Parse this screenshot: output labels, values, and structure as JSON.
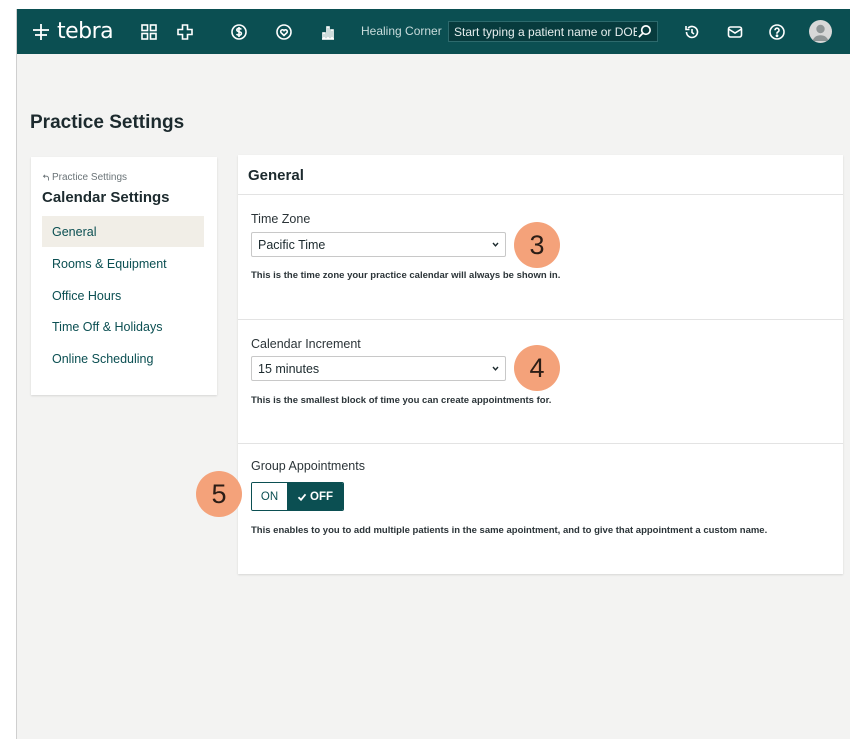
{
  "topbar": {
    "logo_text": "tebra",
    "icons": [
      "apps-grid-icon",
      "medical-cross-icon",
      "dollar-icon",
      "heart-icon",
      "bar-chart-icon"
    ],
    "practice_name": "Healing Corner",
    "search_placeholder": "Start typing a patient name or DOB",
    "right_icons": [
      "history-icon",
      "mail-icon",
      "help-icon",
      "user-avatar"
    ],
    "brand_color": "#0b4f52"
  },
  "page": {
    "title": "Practice Settings"
  },
  "sidebar": {
    "back_label": "Practice Settings",
    "title": "Calendar Settings",
    "items": [
      {
        "label": "General",
        "active": true
      },
      {
        "label": "Rooms & Equipment",
        "active": false
      },
      {
        "label": "Office Hours",
        "active": false
      },
      {
        "label": "Time Off & Holidays",
        "active": false
      },
      {
        "label": "Online Scheduling",
        "active": false
      }
    ]
  },
  "main": {
    "header": "General",
    "time_zone": {
      "label": "Time Zone",
      "value": "Pacific Time",
      "help": "This is the time zone your practice calendar will always be shown in."
    },
    "calendar_increment": {
      "label": "Calendar Increment",
      "value": "15 minutes",
      "help": "This is the smallest block of time you can create appointments for."
    },
    "group_appointments": {
      "label": "Group Appointments",
      "on_label": "ON",
      "off_label": "OFF",
      "state": "off",
      "help": "This enables to you to add multiple patients in the same apointment, and to give that appointment a custom name."
    }
  },
  "callouts": [
    "3",
    "4",
    "5"
  ],
  "callout_color": "#f4a27a"
}
